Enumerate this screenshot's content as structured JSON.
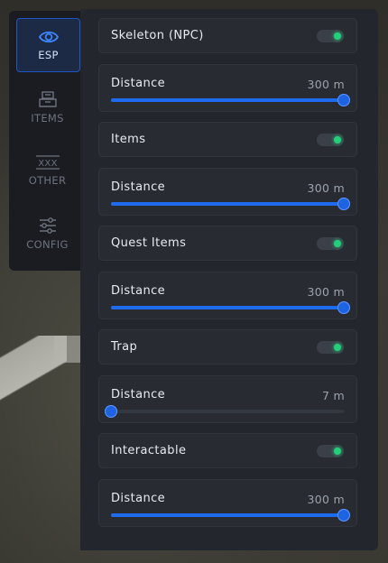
{
  "nav": [
    {
      "key": "esp",
      "label": "ESP",
      "icon": "eye-icon",
      "active": true
    },
    {
      "key": "items",
      "label": "ITEMS",
      "icon": "box-icon",
      "active": false
    },
    {
      "key": "other",
      "label": "OTHER",
      "icon": "xxx-icon",
      "active": false
    },
    {
      "key": "config",
      "label": "CONFIG",
      "icon": "sliders-icon",
      "active": false
    }
  ],
  "settings": [
    {
      "label": "Skeleton (NPC)",
      "enabled": true,
      "distance_label": "Distance",
      "distance_value": "300 m",
      "distance_fraction": 1.0
    },
    {
      "label": "Items",
      "enabled": true,
      "distance_label": "Distance",
      "distance_value": "300 m",
      "distance_fraction": 1.0
    },
    {
      "label": "Quest Items",
      "enabled": true,
      "distance_label": "Distance",
      "distance_value": "300 m",
      "distance_fraction": 1.0
    },
    {
      "label": "Trap",
      "enabled": true,
      "distance_label": "Distance",
      "distance_value": "7 m",
      "distance_fraction": 0.0
    },
    {
      "label": "Interactable",
      "enabled": true,
      "distance_label": "Distance",
      "distance_value": "300 m",
      "distance_fraction": 1.0
    }
  ],
  "colors": {
    "accent": "#1e6bf0",
    "toggle_on": "#22d07a",
    "panel": "#23262c",
    "sidebar": "#1a1c21"
  }
}
